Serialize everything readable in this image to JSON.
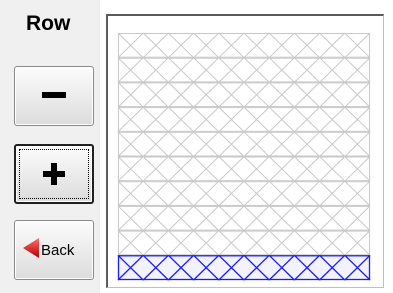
{
  "sidebar": {
    "title": "Row",
    "minus_icon": "minus-icon",
    "plus_icon": "plus-icon",
    "back_icon": "back-arrow-icon",
    "back_label": "Back"
  },
  "grid": {
    "rows": 10,
    "columns": 10,
    "selected_row": 10,
    "pattern_color": "#c8c8c8",
    "selected_color": "#1a1aff",
    "selected_fill": "#f3f3ff"
  }
}
